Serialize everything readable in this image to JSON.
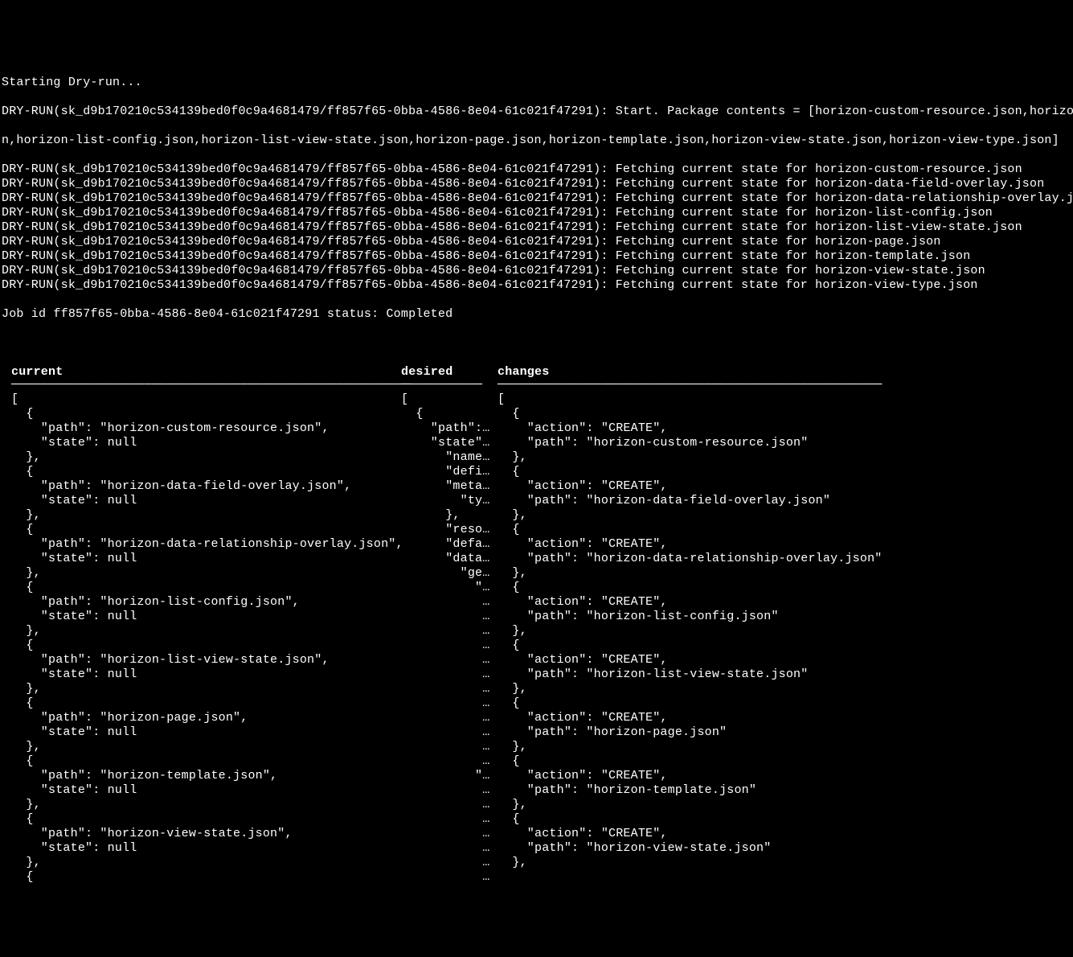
{
  "log": {
    "starting": "Starting Dry-run...",
    "run_prefix": "DRY-RUN(sk_d9b170210c534139bed0f0c9a4681479/ff857f65-0bba-4586-8e04-61c021f47291):",
    "start_line": "DRY-RUN(sk_d9b170210c534139bed0f0c9a4681479/ff857f65-0bba-4586-8e04-61c021f47291): Start. Package contents = [horizon-custom-resource.json,horizon-d",
    "wrap_line": "n,horizon-list-config.json,horizon-list-view-state.json,horizon-page.json,horizon-template.json,horizon-view-state.json,horizon-view-type.json]",
    "fetch_prefix": "Fetching current state for",
    "files": [
      "horizon-custom-resource.json",
      "horizon-data-field-overlay.json",
      "horizon-data-relationship-overlay.json",
      "horizon-list-config.json",
      "horizon-list-view-state.json",
      "horizon-page.json",
      "horizon-template.json",
      "horizon-view-state.json",
      "horizon-view-type.json"
    ],
    "job_line": "Job id ff857f65-0bba-4586-8e04-61c021f47291 status: Completed"
  },
  "columns": {
    "current": {
      "header": "current",
      "rule": "──────────────────────────────────────────────────────",
      "body": "[\n  {\n    \"path\": \"horizon-custom-resource.json\",\n    \"state\": null\n  },\n  {\n    \"path\": \"horizon-data-field-overlay.json\",\n    \"state\": null\n  },\n  {\n    \"path\": \"horizon-data-relationship-overlay.json\",\n    \"state\": null\n  },\n  {\n    \"path\": \"horizon-list-config.json\",\n    \"state\": null\n  },\n  {\n    \"path\": \"horizon-list-view-state.json\",\n    \"state\": null\n  },\n  {\n    \"path\": \"horizon-page.json\",\n    \"state\": null\n  },\n  {\n    \"path\": \"horizon-template.json\",\n    \"state\": null\n  },\n  {\n    \"path\": \"horizon-view-state.json\",\n    \"state\": null\n  },\n  {"
    },
    "desired": {
      "header": "desired",
      "rule": "───────────",
      "body": "[\n  {\n    \"path\":…\n    \"state\"…\n      \"name…\n      \"defi…\n      \"meta…\n        \"ty…\n      },\n      \"reso…\n      \"defa…\n      \"data…\n        \"ge…\n          \"…\n           …\n           …\n           …\n           …\n           …\n           …\n           …\n           …\n           …\n           …\n           …\n           …\n          \"…\n           …\n           …\n           …\n           …\n           …\n           …\n           …"
    },
    "changes": {
      "header": "changes",
      "rule": "────────────────────────────────────────────────────",
      "body": "[\n  {\n    \"action\": \"CREATE\",\n    \"path\": \"horizon-custom-resource.json\"\n  },\n  {\n    \"action\": \"CREATE\",\n    \"path\": \"horizon-data-field-overlay.json\"\n  },\n  {\n    \"action\": \"CREATE\",\n    \"path\": \"horizon-data-relationship-overlay.json\"\n  },\n  {\n    \"action\": \"CREATE\",\n    \"path\": \"horizon-list-config.json\"\n  },\n  {\n    \"action\": \"CREATE\",\n    \"path\": \"horizon-list-view-state.json\"\n  },\n  {\n    \"action\": \"CREATE\",\n    \"path\": \"horizon-page.json\"\n  },\n  {\n    \"action\": \"CREATE\",\n    \"path\": \"horizon-template.json\"\n  },\n  {\n    \"action\": \"CREATE\",\n    \"path\": \"horizon-view-state.json\"\n  },"
    }
  }
}
